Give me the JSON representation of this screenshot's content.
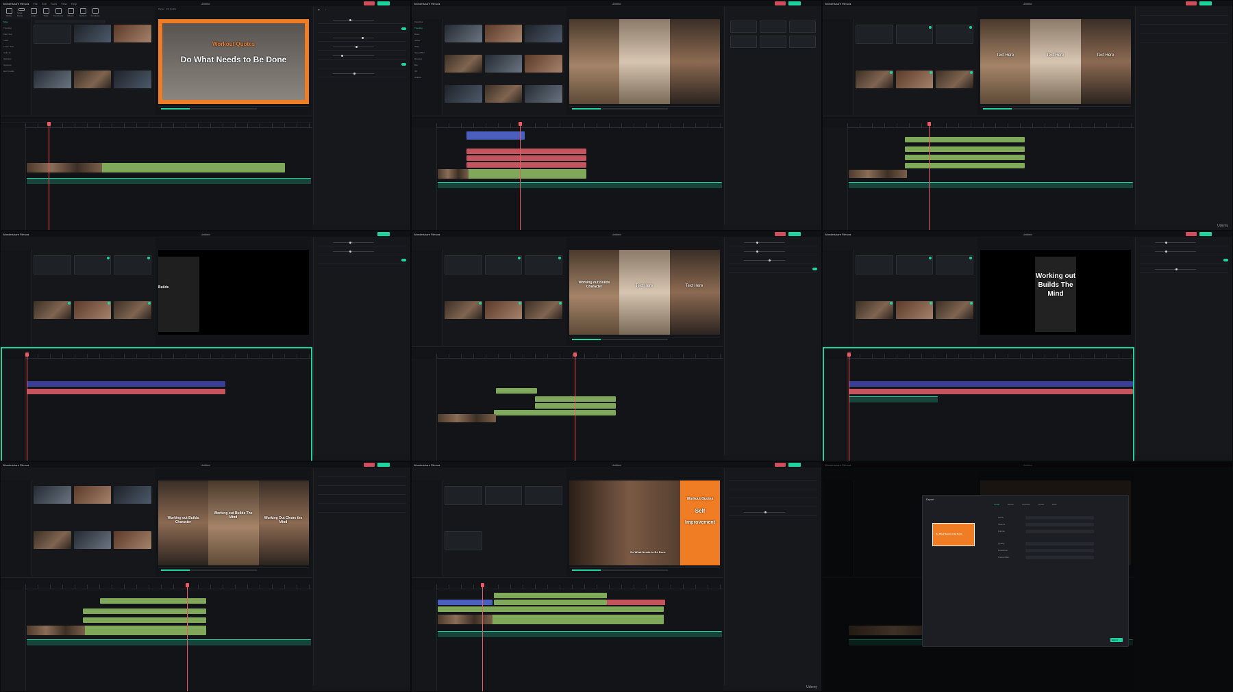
{
  "app": {
    "title": "Wondershare Filmora",
    "project": "Untitled",
    "menu": [
      "File",
      "Edit",
      "Tools",
      "View",
      "Help"
    ],
    "player_label": "Player",
    "quality": "Full Quality",
    "toolbar": [
      "Media",
      "Stock Media",
      "Audio",
      "Titles",
      "Transitions",
      "Effects",
      "Stickers",
      "Templates"
    ],
    "watermark": "Udemy"
  },
  "colors": {
    "accent": "#1fd3a0",
    "playhead": "#ef5867",
    "clip_green": "#7fa85b",
    "clip_red": "#c4545e",
    "orange": "#f07c23"
  },
  "panels": [
    {
      "overlay_title": "Workout Quotes",
      "overlay_main": "Do What Needs to Be Done",
      "side": [
        "Mine",
        "Trending",
        "Plain Text",
        "Titles",
        "Lower 3rds",
        "Callouts",
        "Subtitles",
        "Openers",
        "End Credits"
      ]
    },
    {
      "side": [
        "Favorites",
        "Trending",
        "Basic",
        "Slides",
        "Warp",
        "Speed Blur",
        "Dissolve",
        "Blur",
        "3D",
        "Shapes"
      ]
    },
    {
      "overlay": [
        "Text Here",
        "Text Here",
        "Text Here"
      ]
    },
    {
      "overlay": "Builds"
    },
    {
      "overlay": [
        "Working out Builds Character",
        "Text Here",
        "Text Here"
      ]
    },
    {
      "overlay": "Working out Builds The Mind"
    },
    {
      "overlay": [
        "Working out Builds Character",
        "Working out Builds The Mind",
        "Working Out Clears the Mind"
      ]
    },
    {
      "overlay_orange": [
        "Workout Quotes",
        "Self",
        "Improvement"
      ],
      "overlay_bottom": "Do What Needs to Be Done"
    },
    {
      "dialog": {
        "title": "Export",
        "tabs": [
          "Local",
          "Device",
          "YouTube",
          "Vimeo",
          "DVD"
        ],
        "fields": [
          "Name",
          "Save to",
          "Format",
          "Quality",
          "Resolution",
          "Frame Rate"
        ],
        "thumb_text": "Do What Needs to Be Done",
        "button": "Export"
      }
    }
  ]
}
